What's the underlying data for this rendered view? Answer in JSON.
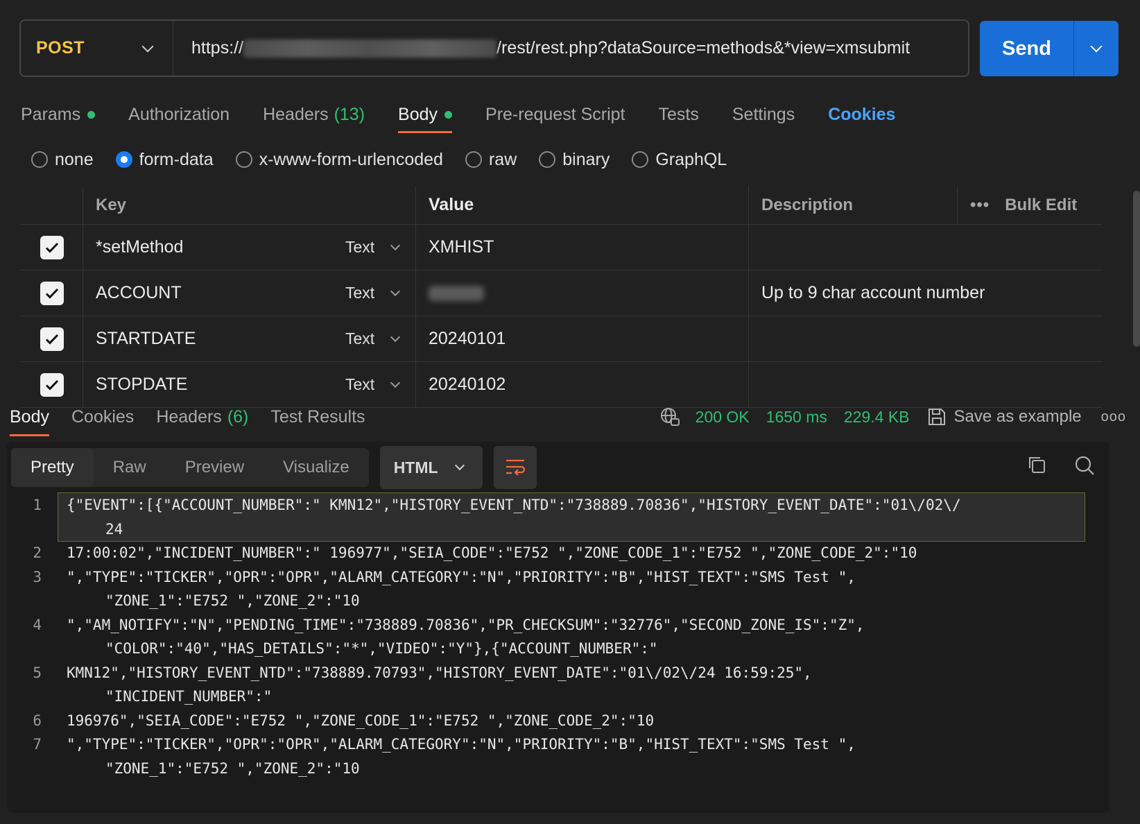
{
  "request": {
    "method": "POST",
    "url_prefix": "https://",
    "url_suffix": "/rest/rest.php?dataSource=methods&*view=xmsubmit",
    "send_label": "Send"
  },
  "req_tabs": {
    "params": "Params",
    "authorization": "Authorization",
    "headers": "Headers",
    "headers_count": "(13)",
    "body": "Body",
    "prerequest": "Pre-request Script",
    "tests": "Tests",
    "settings": "Settings",
    "cookies": "Cookies"
  },
  "body_types": {
    "none": "none",
    "form_data": "form-data",
    "urlencoded": "x-www-form-urlencoded",
    "raw": "raw",
    "binary": "binary",
    "graphql": "GraphQL",
    "selected": "form-data"
  },
  "form_table": {
    "headers": {
      "key": "Key",
      "value": "Value",
      "description": "Description",
      "bulk_edit": "Bulk Edit"
    },
    "rows": [
      {
        "checked": true,
        "key": "*setMethod",
        "type": "Text",
        "value": "XMHIST",
        "description": ""
      },
      {
        "checked": true,
        "key": "ACCOUNT",
        "type": "Text",
        "value": "",
        "description": "Up to 9 char account number"
      },
      {
        "checked": true,
        "key": "STARTDATE",
        "type": "Text",
        "value": "20240101",
        "description": ""
      },
      {
        "checked": true,
        "key": "STOPDATE",
        "type": "Text",
        "value": "20240102",
        "description": ""
      }
    ]
  },
  "response": {
    "tabs": {
      "body": "Body",
      "cookies": "Cookies",
      "headers": "Headers",
      "headers_count": "(6)",
      "test_results": "Test Results"
    },
    "status": "200 OK",
    "time": "1650 ms",
    "size": "229.4 KB",
    "save_example": "Save as example",
    "views": {
      "pretty": "Pretty",
      "raw": "Raw",
      "preview": "Preview",
      "visualize": "Visualize"
    },
    "language": "HTML",
    "lines": [
      {
        "n": "1",
        "text": "{\"EVENT\":[{\"ACCOUNT_NUMBER\":\" KMN12\",\"HISTORY_EVENT_NTD\":\"738889.70836\",\"HISTORY_EVENT_DATE\":\"01\\/02\\/",
        "cont": "24"
      },
      {
        "n": "2",
        "text": "17:00:02\",\"INCIDENT_NUMBER\":\" 196977\",\"SEIA_CODE\":\"E752 \",\"ZONE_CODE_1\":\"E752 \",\"ZONE_CODE_2\":\"10",
        "cont": ""
      },
      {
        "n": "3",
        "text": "\",\"TYPE\":\"TICKER\",\"OPR\":\"OPR\",\"ALARM_CATEGORY\":\"N\",\"PRIORITY\":\"B\",\"HIST_TEXT\":\"SMS Test \",",
        "cont": "\"ZONE_1\":\"E752 \",\"ZONE_2\":\"10"
      },
      {
        "n": "4",
        "text": "\",\"AM_NOTIFY\":\"N\",\"PENDING_TIME\":\"738889.70836\",\"PR_CHECKSUM\":\"32776\",\"SECOND_ZONE_IS\":\"Z\",",
        "cont": "\"COLOR\":\"40\",\"HAS_DETAILS\":\"*\",\"VIDEO\":\"Y\"},{\"ACCOUNT_NUMBER\":\""
      },
      {
        "n": "5",
        "text": "KMN12\",\"HISTORY_EVENT_NTD\":\"738889.70793\",\"HISTORY_EVENT_DATE\":\"01\\/02\\/24 16:59:25\",",
        "cont": "\"INCIDENT_NUMBER\":\""
      },
      {
        "n": "6",
        "text": "196976\",\"SEIA_CODE\":\"E752 \",\"ZONE_CODE_1\":\"E752 \",\"ZONE_CODE_2\":\"10",
        "cont": ""
      },
      {
        "n": "7",
        "text": "\",\"TYPE\":\"TICKER\",\"OPR\":\"OPR\",\"ALARM_CATEGORY\":\"N\",\"PRIORITY\":\"B\",\"HIST_TEXT\":\"SMS Test \",",
        "cont": "\"ZONE_1\":\"E752 \",\"ZONE_2\":\"10"
      }
    ]
  },
  "colors": {
    "method": "#f5c542",
    "send": "#1a6ed8",
    "status_ok": "#2fbf71",
    "active_tab_underline": "#f26b3a",
    "cookies_link": "#4aa3ff",
    "radio_selected": "#1a7cf0"
  },
  "icons": [
    "chevron-down-icon",
    "globe-icon",
    "save-icon",
    "more-icon",
    "wrap-icon",
    "copy-icon",
    "search-icon",
    "checkbox-icon"
  ]
}
